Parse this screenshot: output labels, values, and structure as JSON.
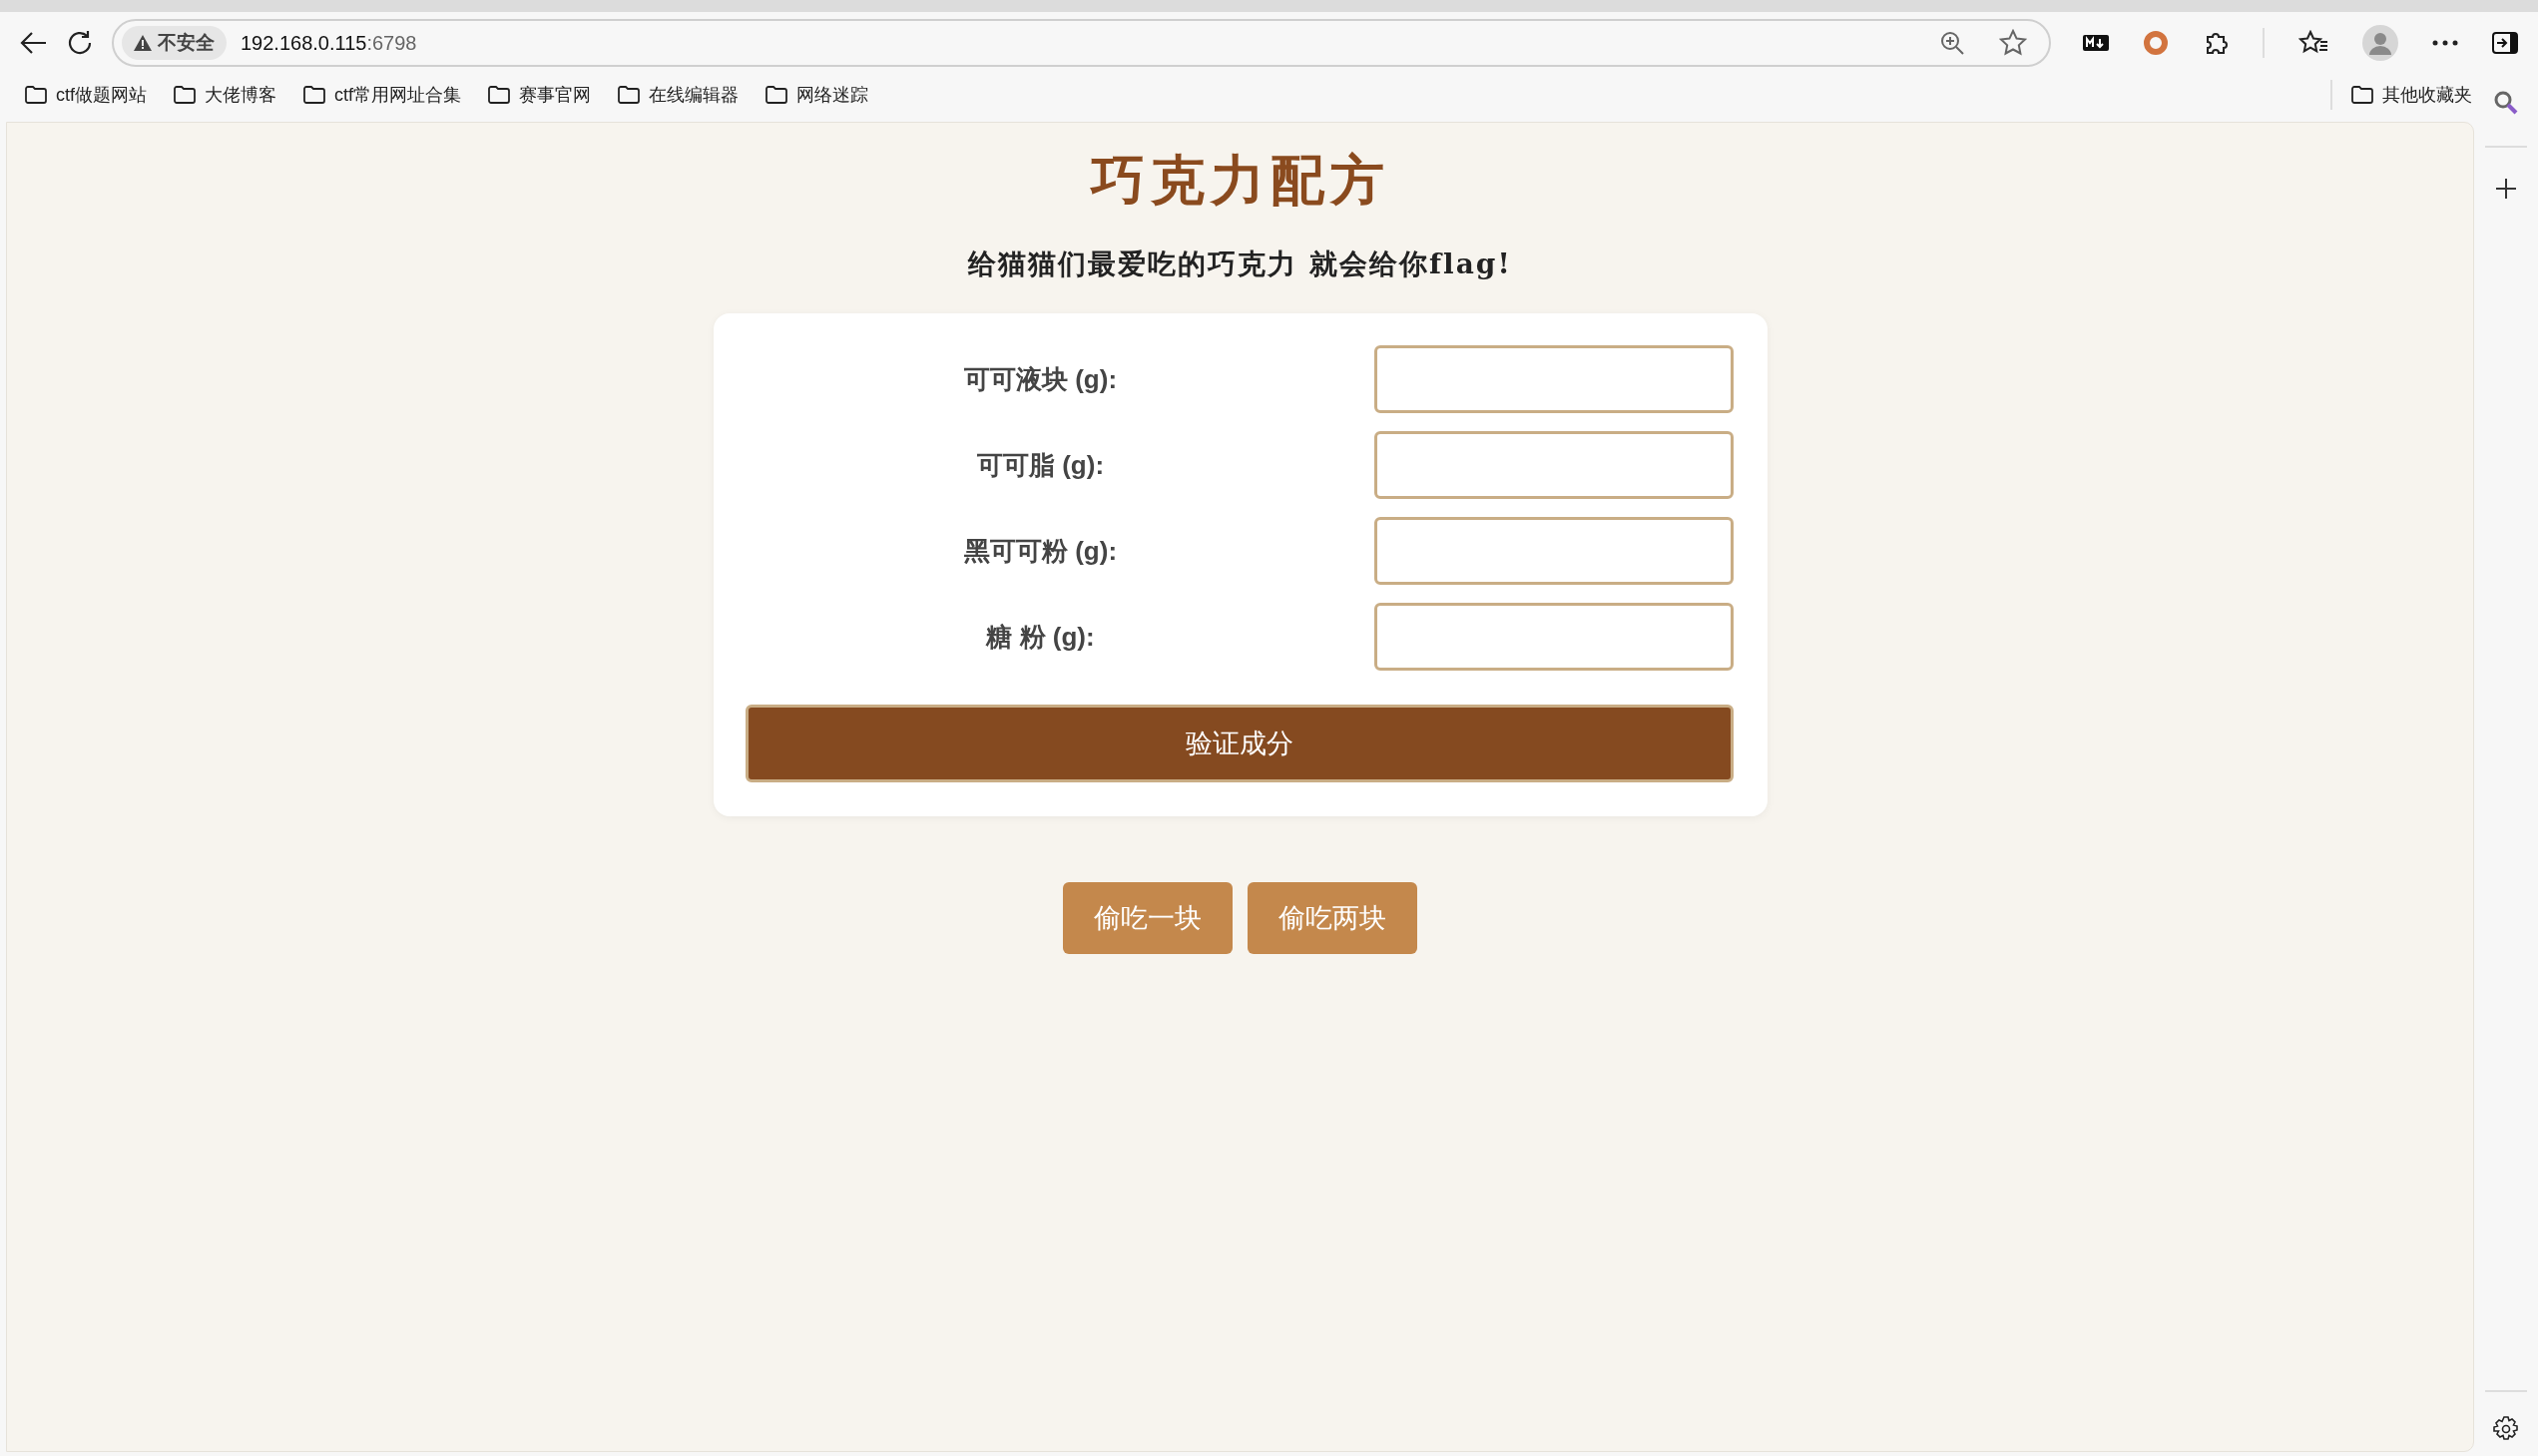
{
  "browser": {
    "security_label": "不安全",
    "url_host": "192.168.0.115",
    "url_port": ":6798"
  },
  "bookmarks": [
    {
      "label": "ctf做题网站"
    },
    {
      "label": "大佬博客"
    },
    {
      "label": "ctf常用网址合集"
    },
    {
      "label": "赛事官网"
    },
    {
      "label": "在线编辑器"
    },
    {
      "label": "网络迷踪"
    }
  ],
  "other_bookmarks": "其他收藏夹",
  "page": {
    "title": "巧克力配方",
    "subtitle": "给猫猫们最爱吃的巧克力 就会给你flag!",
    "fields": [
      {
        "label": "可可液块 (g):"
      },
      {
        "label": "可可脂 (g):"
      },
      {
        "label": "黑可可粉 (g):"
      },
      {
        "label": "糖 粉 (g):"
      }
    ],
    "submit": "验证成分",
    "actions": [
      "偷吃一块",
      "偷吃两块"
    ]
  }
}
